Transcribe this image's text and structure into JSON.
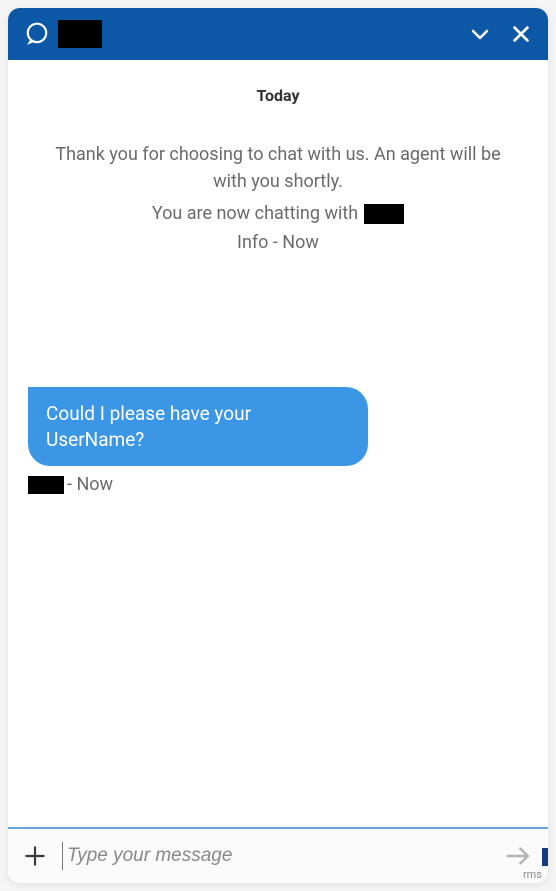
{
  "header": {
    "title_redacted": true
  },
  "date_label": "Today",
  "system_messages": {
    "welcome": "Thank you for choosing to chat with us. An agent will be with you shortly.",
    "now_chatting_prefix": "You are now chatting with",
    "meta": "Info - Now"
  },
  "agent_message": {
    "text": "Could I please have your UserName?",
    "meta_suffix": "- Now"
  },
  "input": {
    "placeholder": "Type your message"
  },
  "footer": {
    "badge_text": "rms"
  },
  "icons": {
    "chat": "chat-bubble-icon",
    "chevron": "chevron-down-icon",
    "close": "close-icon",
    "plus": "plus-icon",
    "send": "send-icon"
  },
  "colors": {
    "header_bg": "#0d58a6",
    "bubble_bg": "#3c96e6",
    "separator": "#67a6dc"
  }
}
